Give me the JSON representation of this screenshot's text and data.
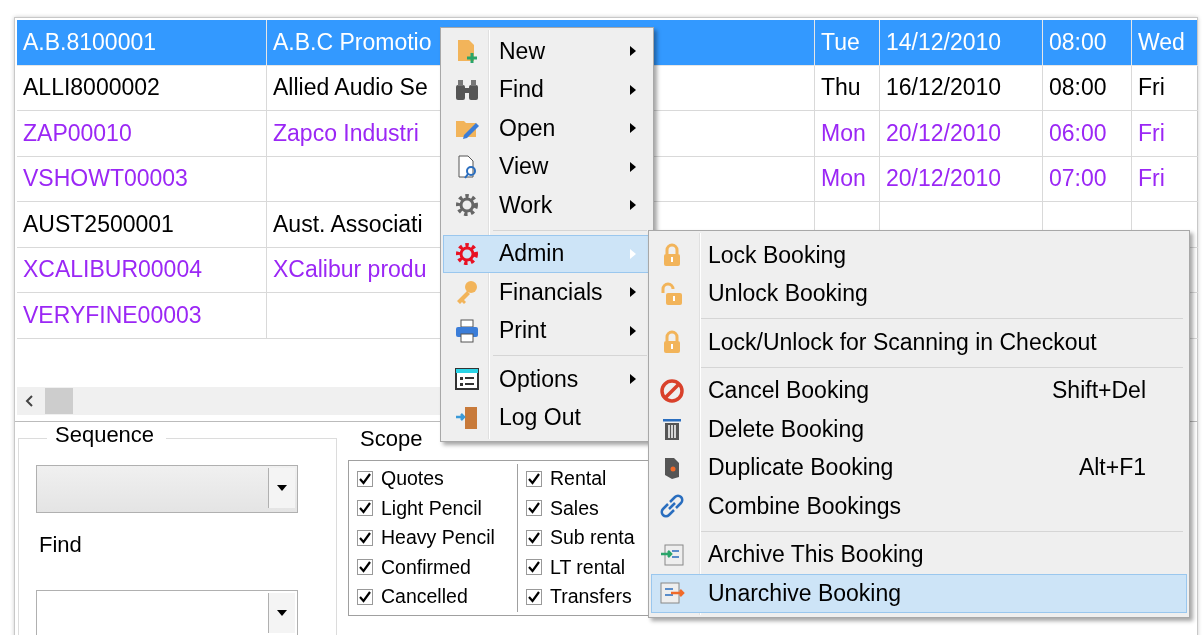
{
  "table": {
    "rows": [
      {
        "code": "A.B.8100001",
        "client": "A.B.C Promotio",
        "day": "Tue",
        "date": "14/12/2010",
        "time": "08:00",
        "column_6": "Wed",
        "selected": true
      },
      {
        "code": "ALLI8000002",
        "client": "Allied Audio Se",
        "day": "Thu",
        "date": "16/12/2010",
        "time": "08:00",
        "column_6": "Fri",
        "selected": false,
        "color": "#000000"
      },
      {
        "code": "ZAP00010",
        "client": "Zapco Industri",
        "day": "Mon",
        "date": "20/12/2010",
        "time": "06:00",
        "column_6": "Fri",
        "selected": false,
        "color": "#9b27f5"
      },
      {
        "code": "VSHOWT00003",
        "day": "Mon",
        "date": "20/12/2010",
        "time": "07:00",
        "column_6": "Fri",
        "selected": false,
        "color": "#9b27f5"
      },
      {
        "code": "AUST2500001",
        "client": "Aust. Associati",
        "selected": false,
        "color": "#000000"
      },
      {
        "code": "XCALIBUR00004",
        "client": "XCalibur produ",
        "selected": false,
        "color": "#9b27f5"
      },
      {
        "code": "VERYFINE00003",
        "selected": false,
        "color": "#9b27f5"
      }
    ]
  },
  "sequence": {
    "label": "Sequence"
  },
  "find": {
    "label": "Find"
  },
  "scope": {
    "label": "Scope",
    "checkboxes": [
      {
        "label": "Quotes",
        "checked": true
      },
      {
        "label": "Light Pencil",
        "checked": true
      },
      {
        "label": "Heavy Pencil",
        "checked": true
      },
      {
        "label": "Confirmed",
        "checked": true
      },
      {
        "label": "Cancelled",
        "checked": true
      },
      {
        "label": "Rental",
        "checked": true
      },
      {
        "label": "Sales",
        "checked": true
      },
      {
        "label": "Sub renta",
        "checked": true
      },
      {
        "label": "LT rental",
        "checked": true
      },
      {
        "label": "Transfers",
        "checked": true
      }
    ]
  },
  "context_menu": {
    "items": [
      {
        "label": "New",
        "selected": false,
        "separator_before": false
      },
      {
        "label": "Find",
        "selected": false,
        "separator_before": false
      },
      {
        "label": "Open",
        "selected": false,
        "separator_before": false
      },
      {
        "label": "View",
        "selected": false,
        "separator_before": false
      },
      {
        "label": "Work",
        "selected": false,
        "separator_before": false
      },
      {
        "label": "Admin",
        "selected": true,
        "separator_before": true
      },
      {
        "label": "Financials",
        "selected": false,
        "separator_before": false
      },
      {
        "label": "Print",
        "selected": false,
        "separator_before": false
      },
      {
        "label": "Options",
        "selected": false,
        "separator_before": true
      },
      {
        "label": "Log Out",
        "selected": false,
        "separator_before": false
      }
    ]
  },
  "submenu": {
    "items": [
      {
        "label": "Lock Booking",
        "selected": false,
        "separator_before": false
      },
      {
        "label": "Unlock Booking",
        "selected": false,
        "separator_before": false
      },
      {
        "label": "Lock/Unlock for Scanning in Checkout",
        "selected": false,
        "separator_before": true
      },
      {
        "label": "Cancel Booking",
        "shortcut": "Shift+Del",
        "selected": false,
        "separator_before": true
      },
      {
        "label": "Delete Booking",
        "selected": false,
        "separator_before": false
      },
      {
        "label": "Duplicate Booking",
        "shortcut": "Alt+F1",
        "selected": false,
        "separator_before": false
      },
      {
        "label": "Combine Bookings",
        "selected": false,
        "separator_before": false
      },
      {
        "label": "Archive This Booking",
        "selected": false,
        "separator_before": true
      },
      {
        "label": "Unarchive Booking",
        "selected": true,
        "separator_before": false
      }
    ]
  }
}
